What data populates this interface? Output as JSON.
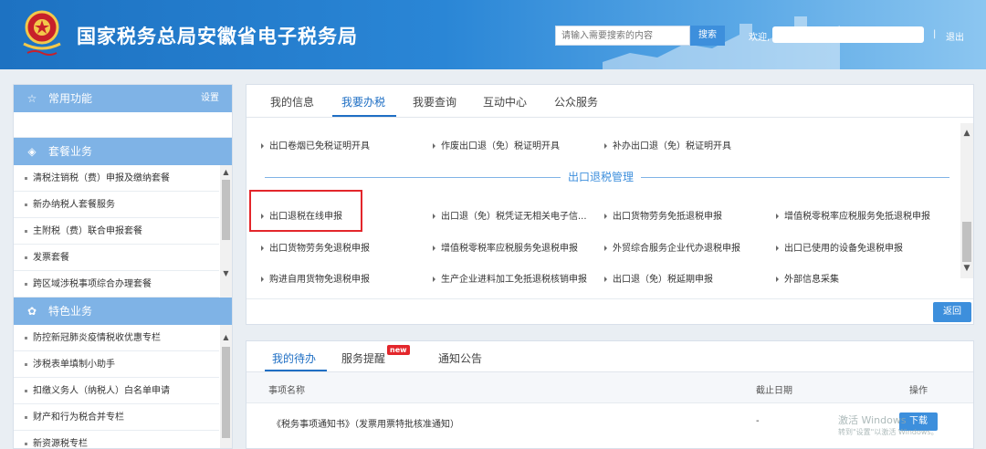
{
  "header": {
    "title": "国家税务总局安徽省电子税务局",
    "search_placeholder": "请输入需要搜索的内容",
    "search_button": "搜索",
    "welcome": "欢迎,",
    "separator": "|",
    "logout": "退出",
    "emblem_icon": "tax-emblem-icon"
  },
  "sidebar": {
    "common": {
      "title": "常用功能",
      "settings": "设置",
      "icon": "star-icon"
    },
    "package": {
      "title": "套餐业务",
      "icon": "layers-icon",
      "items": [
        "清税注销税（费）申报及缴纳套餐",
        "新办纳税人套餐服务",
        "主附税（费）联合申报套餐",
        "发票套餐",
        "跨区域涉税事项综合办理套餐"
      ]
    },
    "special": {
      "title": "特色业务",
      "icon": "flower-icon",
      "items": [
        "防控新冠肺炎疫情税收优惠专栏",
        "涉税表单填制小助手",
        "扣缴义务人（纳税人）白名单申请",
        "财产和行为税合并专栏",
        "新资源税专栏"
      ]
    }
  },
  "main": {
    "tabs": [
      "我的信息",
      "我要办税",
      "我要查询",
      "互动中心",
      "公众服务"
    ],
    "active_tab": "我要办税",
    "top_links": [
      "出口卷烟已免税证明开具",
      "作废出口退（免）税证明开具",
      "补办出口退（免）税证明开具"
    ],
    "section_title": "出口退税管理",
    "rows": [
      [
        "出口退税在线申报",
        "出口退（免）税凭证无相关电子信...",
        "出口货物劳务免抵退税申报",
        "增值税零税率应税服务免抵退税申报"
      ],
      [
        "出口货物劳务免退税申报",
        "增值税零税率应税服务免退税申报",
        "外贸综合服务企业代办退税申报",
        "出口已使用的设备免退税申报"
      ],
      [
        "购进自用货物免退税申报",
        "生产企业进料加工免抵退税核销申报",
        "出口退（免）税延期申报",
        "外部信息采集"
      ]
    ],
    "back_button": "返回"
  },
  "bottom": {
    "tabs": [
      "我的待办",
      "服务提醒",
      "通知公告"
    ],
    "badge": "new",
    "columns": [
      "事项名称",
      "截止日期",
      "操作"
    ],
    "row": {
      "name": "《税务事项通知书》（发票用票特批核准通知）",
      "deadline": "-",
      "action": "下载"
    },
    "watermark_line1": "激活 Windows",
    "watermark_line2": "转到\"设置\"以激活 Windows。"
  },
  "colors": {
    "header_blue": "#2a86d6",
    "accent": "#3d8fdc",
    "sidebar_head": "#7fb3e6",
    "highlight": "#e3262b"
  }
}
